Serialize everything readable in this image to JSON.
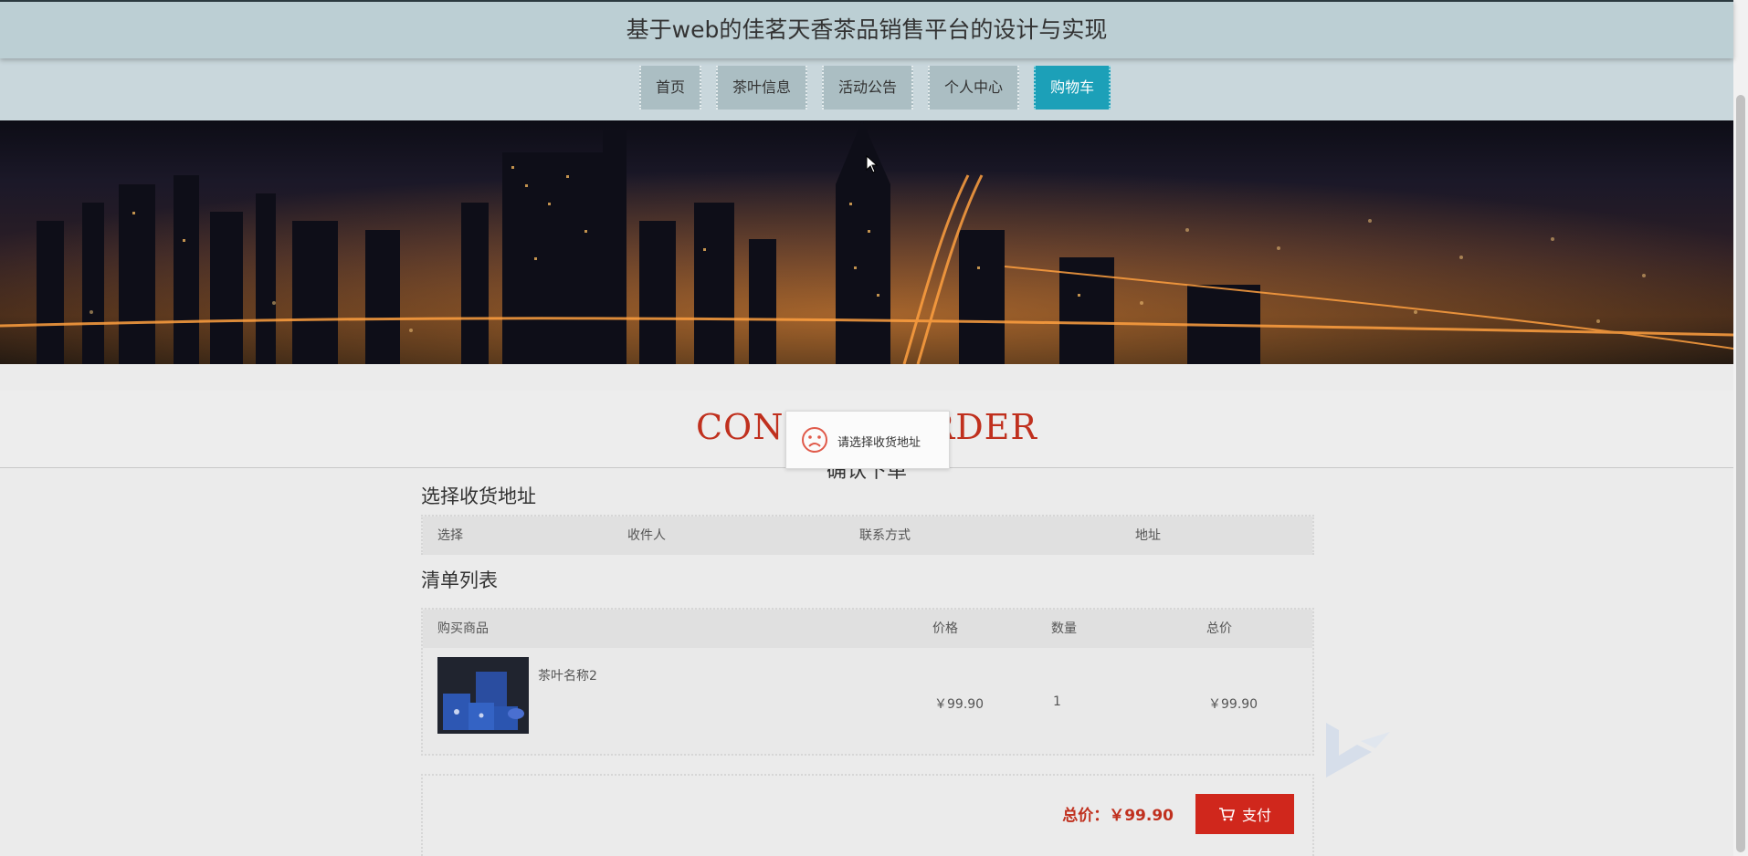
{
  "header": {
    "title": "基于web的佳茗天香茶品销售平台的设计与实现"
  },
  "nav": {
    "items": [
      {
        "label": "首页",
        "active": false
      },
      {
        "label": "茶叶信息",
        "active": false
      },
      {
        "label": "活动公告",
        "active": false
      },
      {
        "label": "个人中心",
        "active": false
      },
      {
        "label": "购物车",
        "active": true
      }
    ]
  },
  "section": {
    "title_en": "CONFIRM ORDER",
    "title_cn": "确认下单"
  },
  "toast": {
    "icon": "sad-face-icon",
    "message": "请选择收货地址"
  },
  "address": {
    "title": "选择收货地址",
    "columns": [
      "选择",
      "收件人",
      "联系方式",
      "地址"
    ]
  },
  "order_list": {
    "title": "清单列表",
    "columns": [
      "购买商品",
      "价格",
      "数量",
      "总价"
    ],
    "rows": [
      {
        "name": "茶叶名称2",
        "price": "￥99.90",
        "quantity": "1",
        "total": "￥99.90"
      }
    ]
  },
  "summary": {
    "total_label": "总价：",
    "total_value": "￥99.90",
    "pay_label": "支付",
    "pay_icon": "cart-icon"
  },
  "colors": {
    "accent_teal": "#1ca0b8",
    "accent_red": "#c0301e",
    "pay_red": "#d0271c"
  }
}
